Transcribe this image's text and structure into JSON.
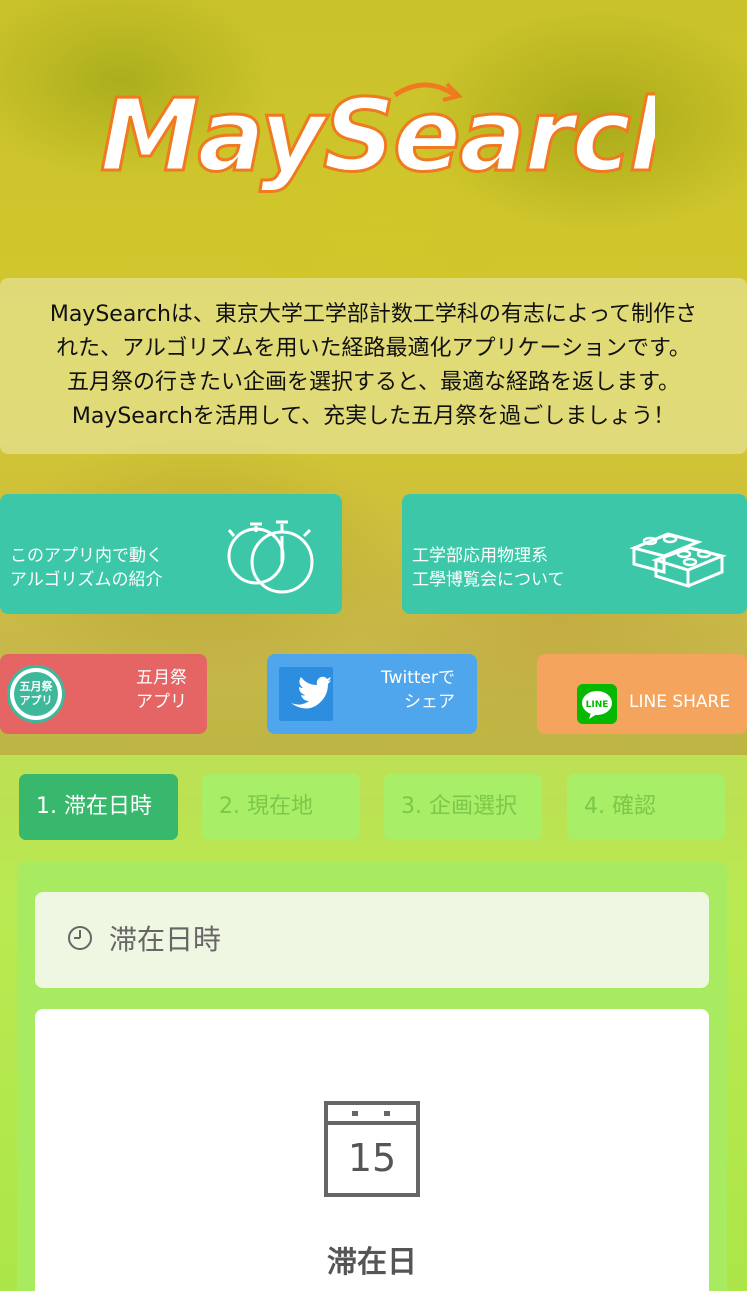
{
  "logo": {
    "text": "MaySearch"
  },
  "description": {
    "lines": [
      "MaySearchは、東京大学工学部計数工学科の有志によって制作さ",
      "れた、アルゴリズムを用いた経路最適化アプリケーションです。",
      "五月祭の行きたい企画を選択すると、最適な経路を返します。",
      "MaySearchを活用して、充実した五月祭を過ごしましょう！"
    ]
  },
  "feature_buttons": {
    "algorithm": {
      "line1": "このアプリ内で動く",
      "line2": "アルゴリズムの紹介",
      "icon": "stopwatch-icon"
    },
    "expo": {
      "line1": "工学部応用物理系",
      "line2": "工學博覧会について",
      "icon": "blocks-icon"
    }
  },
  "share_buttons": {
    "app": {
      "badge_line1": "五月祭",
      "badge_line2": "アプリ",
      "line1": "五月祭",
      "line2": "アプリ"
    },
    "twitter": {
      "line1": "Twitterで",
      "line2": "シェア"
    },
    "line": {
      "badge": "LINE",
      "label": "LINE SHARE"
    }
  },
  "steps": [
    {
      "label": "1. 滞在日時",
      "active": true
    },
    {
      "label": "2. 現在地",
      "active": false
    },
    {
      "label": "3. 企画選択",
      "active": false
    },
    {
      "label": "4. 確認",
      "active": false
    }
  ],
  "panel": {
    "title": "滞在日時",
    "calendar_day": "15",
    "card_label": "滞在日"
  },
  "colors": {
    "teal": "#3cc8a8",
    "app_red": "#e56464",
    "twitter_blue": "#4fa6ec",
    "line_orange": "#f4a45c",
    "step_active": "#38b86c",
    "step_inactive": "#a8ee66"
  }
}
